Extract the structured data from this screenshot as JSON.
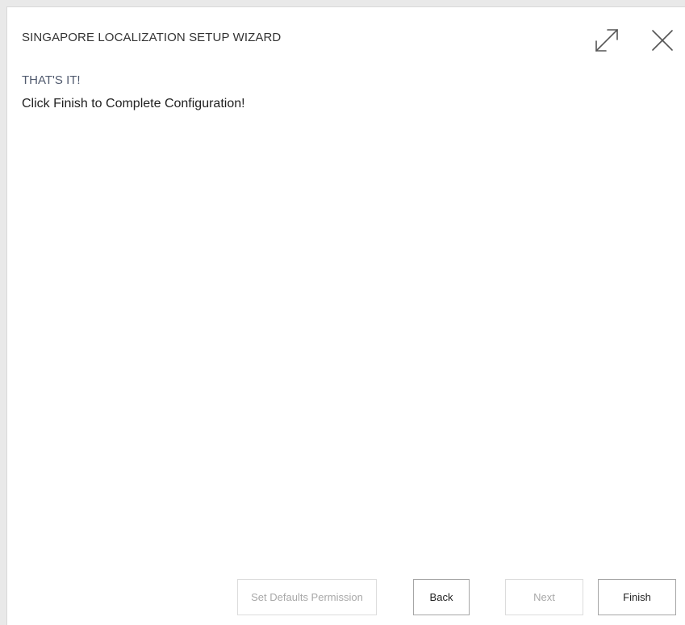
{
  "dialog": {
    "title": "SINGAPORE LOCALIZATION SETUP WIZARD",
    "expand_icon": "expand-icon",
    "close_icon": "close-icon"
  },
  "content": {
    "heading": "THAT'S IT!",
    "message": "Click Finish to Complete Configuration!"
  },
  "footer": {
    "set_defaults_label": "Set Defaults Permission",
    "back_label": "Back",
    "next_label": "Next",
    "finish_label": "Finish"
  },
  "colors": {
    "heading": "#505a6e",
    "disabled_text": "#a8a8a8",
    "border": "#a6a6a6"
  }
}
